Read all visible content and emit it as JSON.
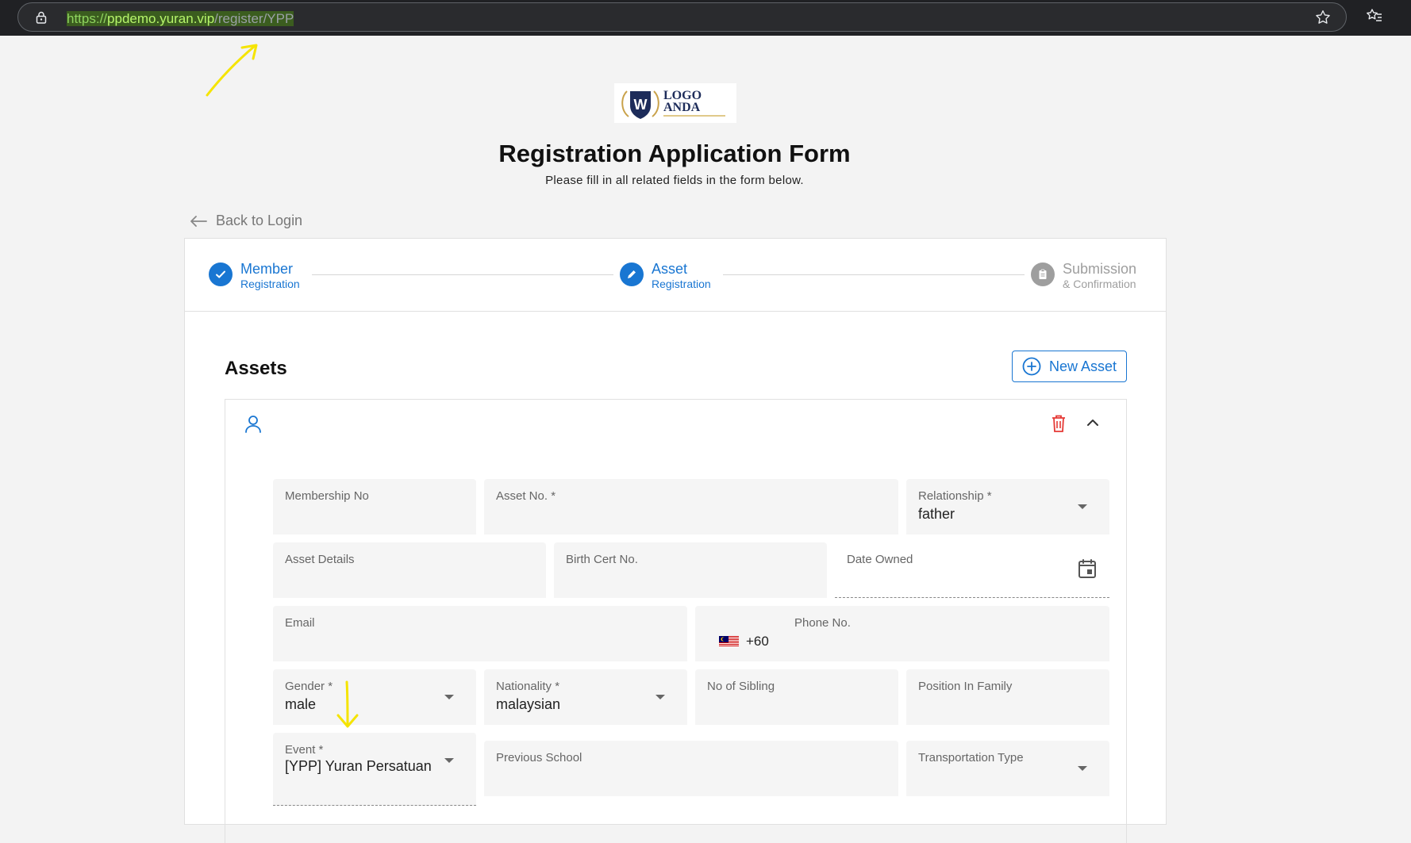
{
  "browser": {
    "url_proto": "https://",
    "url_domain": "ppdemo.yuran.vip",
    "url_path": "/register/YPP"
  },
  "header": {
    "logo_line1": "LOGO",
    "logo_line2": "ANDA",
    "title": "Registration Application Form",
    "subtitle": "Please fill in all related fields in the form below.",
    "back_label": "Back to Login"
  },
  "stepper": {
    "steps": [
      {
        "title": "Member",
        "sub": "Registration",
        "state": "done"
      },
      {
        "title": "Asset",
        "sub": "Registration",
        "state": "active"
      },
      {
        "title": "Submission",
        "sub": "& Confirmation",
        "state": "pending"
      }
    ]
  },
  "assets": {
    "heading": "Assets",
    "new_button": "New Asset"
  },
  "form": {
    "membership_no": {
      "label": "Membership No",
      "value": ""
    },
    "asset_no": {
      "label": "Asset No. *",
      "value": ""
    },
    "relationship": {
      "label": "Relationship *",
      "value": "father"
    },
    "asset_details": {
      "label": "Asset Details",
      "value": ""
    },
    "birth_cert": {
      "label": "Birth Cert No.",
      "value": ""
    },
    "date_owned": {
      "label": "Date Owned",
      "value": ""
    },
    "email": {
      "label": "Email",
      "value": ""
    },
    "phone": {
      "label": "Phone No.",
      "prefix": "+60",
      "value": ""
    },
    "gender": {
      "label": "Gender *",
      "value": "male"
    },
    "nationality": {
      "label": "Nationality *",
      "value": "malaysian"
    },
    "siblings": {
      "label": "No of Sibling",
      "value": ""
    },
    "position": {
      "label": "Position In Family",
      "value": ""
    },
    "event": {
      "label": "Event *",
      "value": "[YPP] Yuran Persatuan"
    },
    "prev_school": {
      "label": "Previous School",
      "value": ""
    },
    "transport": {
      "label": "Transportation Type",
      "value": ""
    }
  },
  "colors": {
    "accent": "#1976d2",
    "delete": "#e53935",
    "annotation": "#f5e400"
  }
}
